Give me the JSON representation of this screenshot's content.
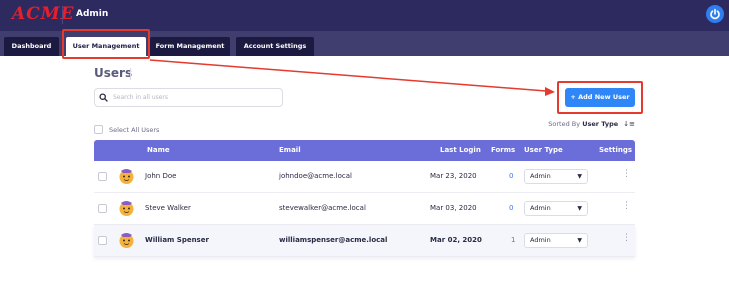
{
  "header": {
    "logo": "ACME",
    "title": "Admin"
  },
  "tabs": [
    {
      "label": "Dashboard"
    },
    {
      "label": "User Management"
    },
    {
      "label": "Form Management"
    },
    {
      "label": "Account Settings"
    }
  ],
  "active_tab": "User Management",
  "page": {
    "title": "Users",
    "search_placeholder": "Search in all users",
    "add_button": "+ Add New User",
    "select_all": "Select All Users",
    "sorted_by_label": "Sorted By",
    "sorted_by_value": "User Type",
    "sort_icon": "↓≡"
  },
  "table": {
    "columns": {
      "name": "Name",
      "email": "Email",
      "last_login": "Last Login",
      "forms": "Forms",
      "user_type": "User Type",
      "settings": "Settings"
    },
    "rows": [
      {
        "name": "John Doe",
        "email": "johndoe@acme.local",
        "last_login": "Mar 23, 2020",
        "forms": "0",
        "user_type": "Admin"
      },
      {
        "name": "Steve Walker",
        "email": "stevewalker@acme.local",
        "last_login": "Mar 03, 2020",
        "forms": "0",
        "user_type": "Admin"
      },
      {
        "name": "William Spenser",
        "email": "williamspenser@acme.local",
        "last_login": "Mar 02, 2020",
        "forms": "1",
        "user_type": "Admin"
      }
    ]
  },
  "colors": {
    "header_bg": "#2d2a60",
    "tabbar_bg": "#403e6f",
    "accent": "#2f86f6",
    "table_header": "#6b6dd9",
    "annotation": "#e53a2e"
  }
}
